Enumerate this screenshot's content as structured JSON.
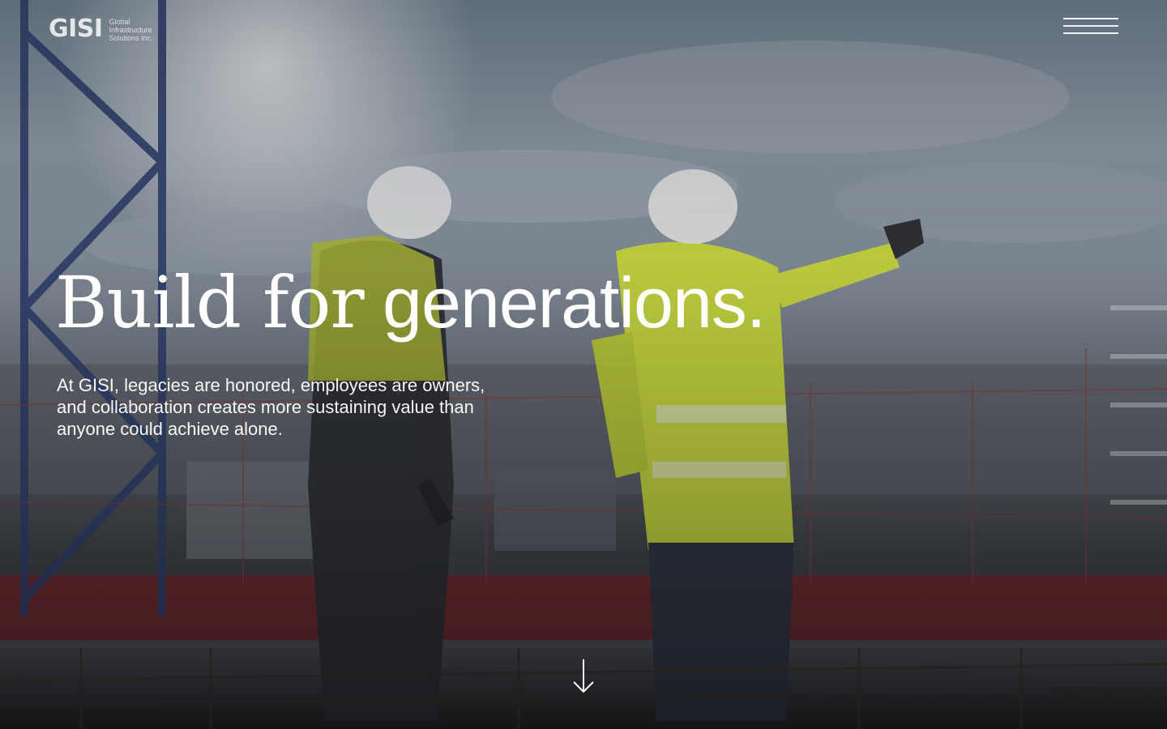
{
  "brand": {
    "logo_mark": "GISI",
    "logo_lines": [
      "Global",
      "Infrastructure",
      "Solutions Inc."
    ]
  },
  "nav": {
    "menu_icon": "hamburger-menu-icon"
  },
  "hero": {
    "headline_part1": "Build for",
    "headline_part2": "generations.",
    "tagline": "At GISI, legacies are honored, employees are owners, and collaboration creates more sustaining value than anyone could achieve alone.",
    "scroll_icon": "arrow-down-icon",
    "background_image": "construction-workers-on-rooftop"
  },
  "colors": {
    "text": "#ffffff",
    "safety_vest": "#cfe03a"
  }
}
